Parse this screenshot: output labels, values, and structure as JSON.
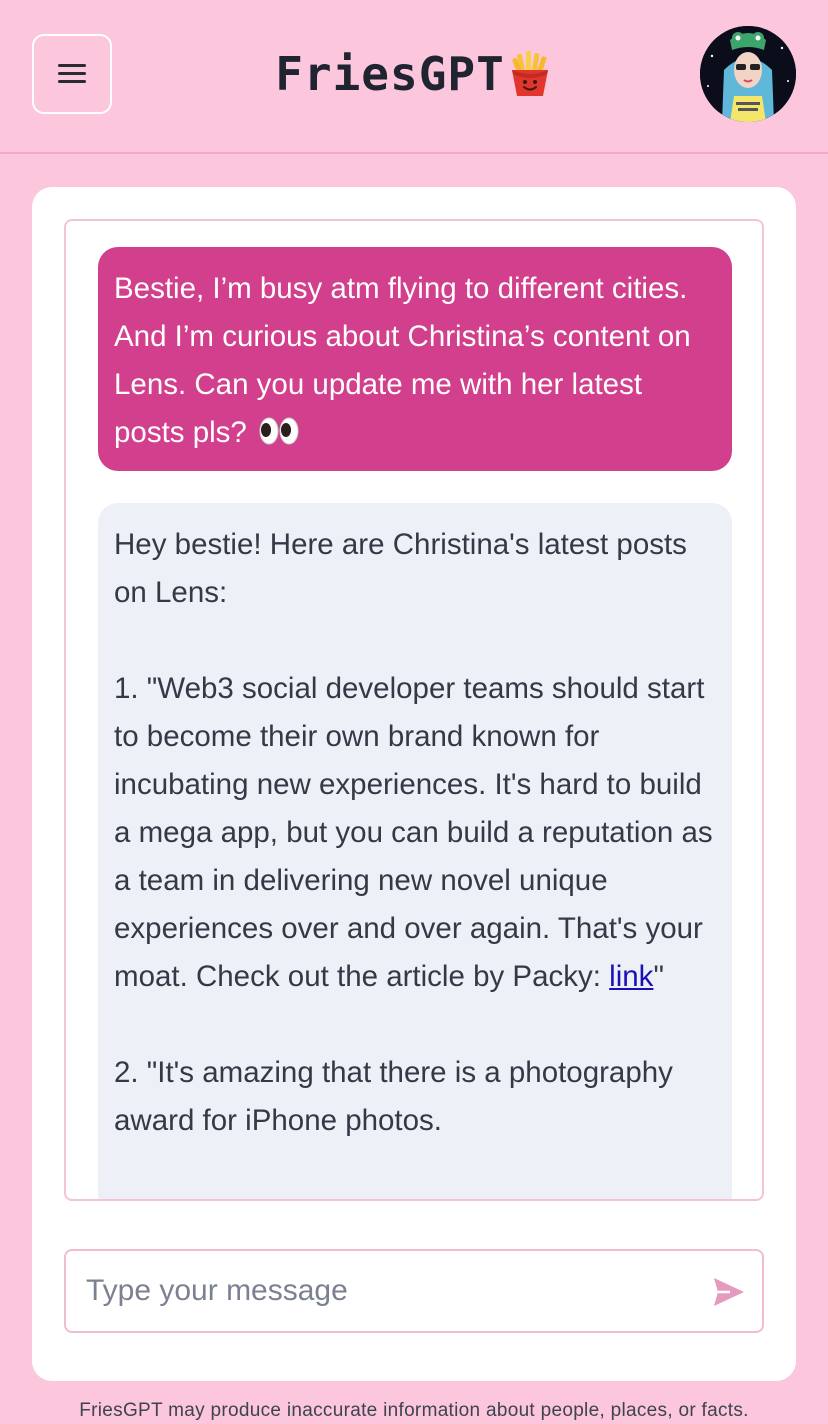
{
  "app": {
    "title": "FriesGPT"
  },
  "header": {
    "menu_icon": "hamburger-icon",
    "brand_icon": "fries-icon",
    "avatar_icon": "user-avatar"
  },
  "chat": {
    "user_message": "Bestie, I’m busy atm flying to different cities. And I’m curious about Christina’s content on Lens. Can you update me with her latest posts pls?",
    "user_emoji": "eyes-emoji",
    "bot_intro": "Hey bestie! Here are Christina's latest posts on Lens:",
    "bot_item1_before": "1. \"Web3 social developer teams should start to become their own brand known for incubating new experiences. It's hard to build a mega app, but you can build a reputation as a team in delivering new novel unique experiences over and over again. That's your moat. Check out the article by Packy: ",
    "bot_item1_link": "link",
    "bot_item1_after": "\"",
    "bot_item2": "2. \"It's amazing that there is a photography award for iPhone photos."
  },
  "composer": {
    "placeholder": "Type your message",
    "send_icon": "send-icon"
  },
  "footer": {
    "disclaimer": "FriesGPT may produce inaccurate information about people, places, or facts."
  },
  "colors": {
    "background": "#fcc6dd",
    "user_bubble": "#d23f8c",
    "bot_bubble": "#eef0f8",
    "link": "#1a10b8",
    "send_icon": "#e49bbd"
  }
}
